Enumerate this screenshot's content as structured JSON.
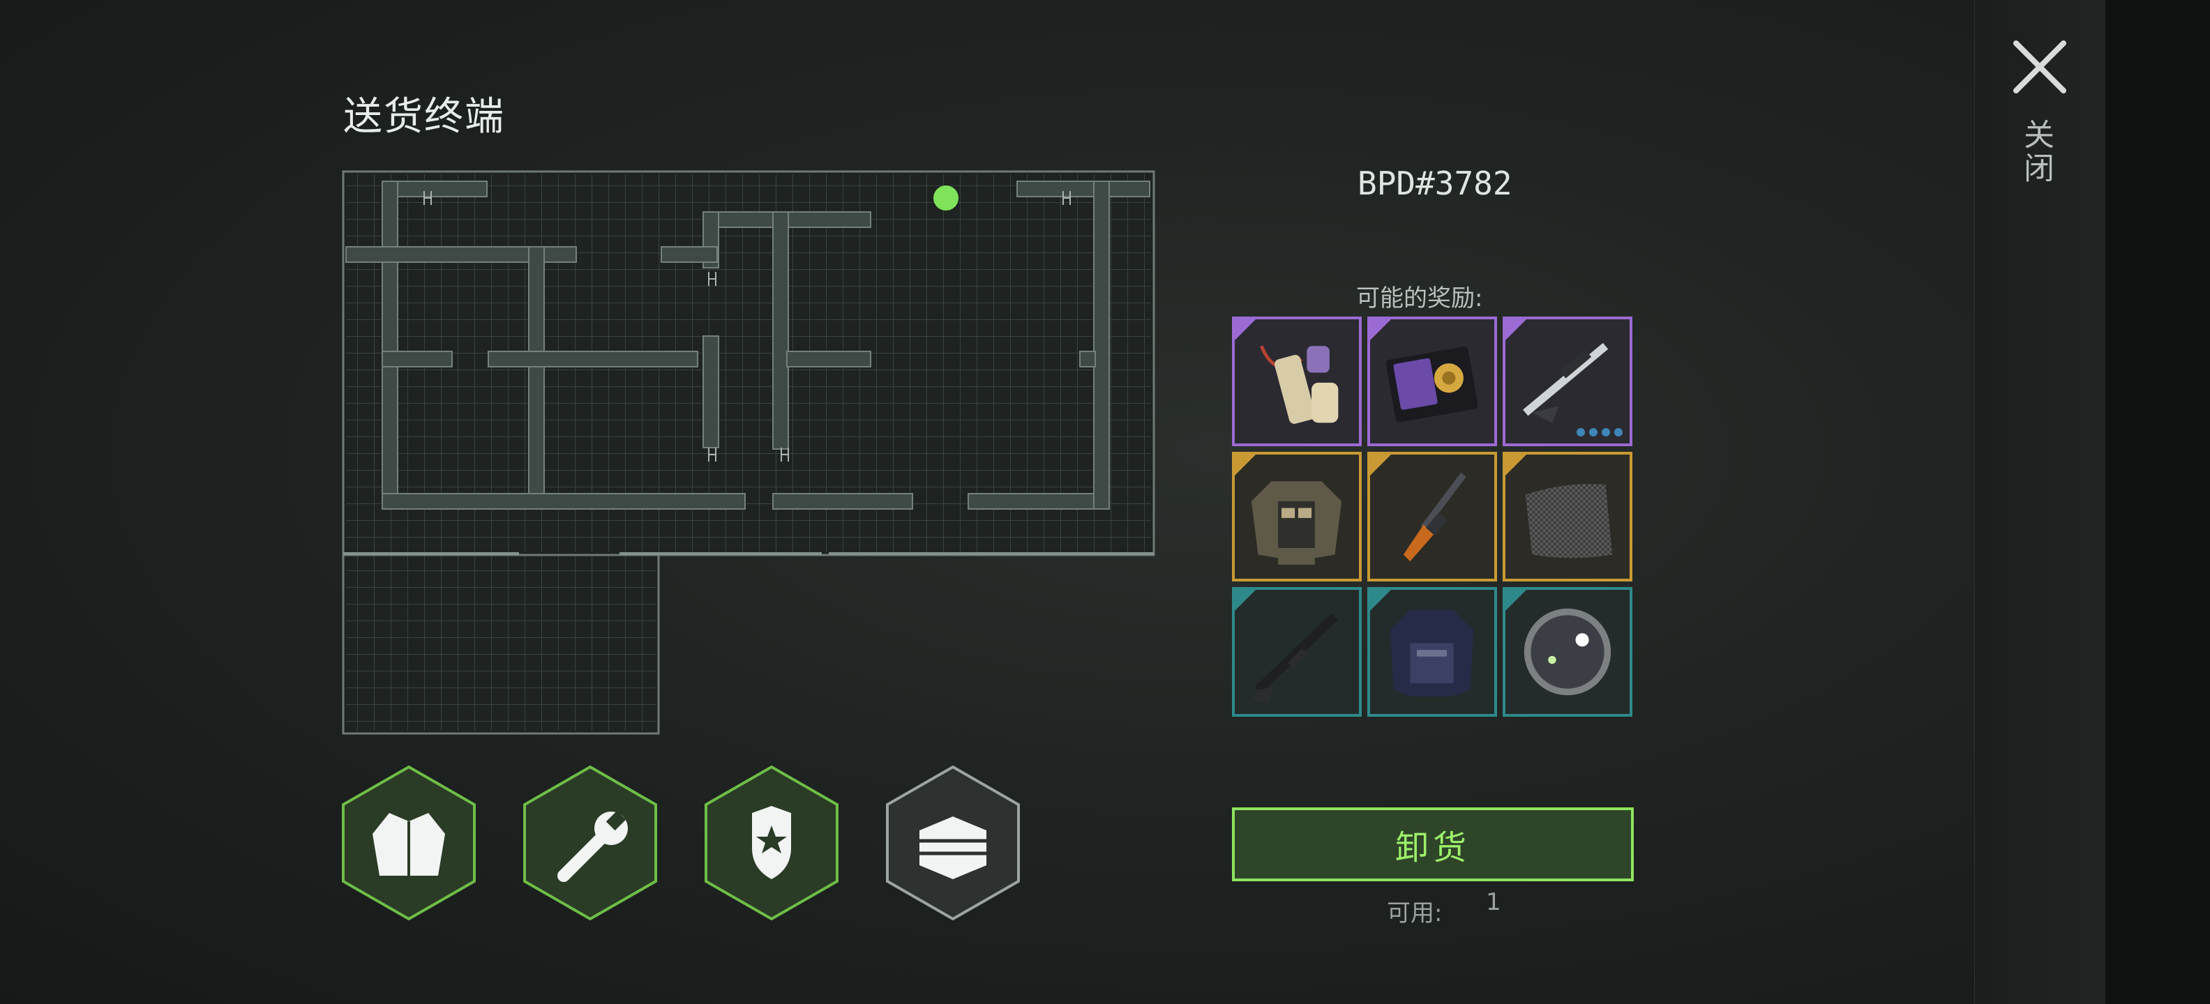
{
  "header": {
    "title": "送货终端"
  },
  "terminal": {
    "code": "BPD#3782"
  },
  "rewards": {
    "label": "可能的奖励:",
    "items": [
      {
        "name": "scroll-pack",
        "rarity": "purple"
      },
      {
        "name": "police-badge-wallet",
        "rarity": "purple"
      },
      {
        "name": "sniper-rifle",
        "rarity": "purple",
        "dots": 4
      },
      {
        "name": "tactical-jacket",
        "rarity": "gold"
      },
      {
        "name": "pistol-carbine",
        "rarity": "gold"
      },
      {
        "name": "carbon-fabric",
        "rarity": "gold"
      },
      {
        "name": "assault-rifle",
        "rarity": "teal"
      },
      {
        "name": "police-vest",
        "rarity": "teal"
      },
      {
        "name": "optic-lens",
        "rarity": "teal"
      }
    ]
  },
  "actions": {
    "unload_label": "卸货",
    "available_label": "可用:",
    "available_value": "1",
    "close_label": "关闭"
  },
  "categories": [
    {
      "name": "clothing",
      "icon": "jacket-icon",
      "state": "active"
    },
    {
      "name": "tools",
      "icon": "wrench-icon",
      "state": "active"
    },
    {
      "name": "police",
      "icon": "police-badge-icon",
      "state": "selected"
    },
    {
      "name": "supplies",
      "icon": "crate-icon",
      "state": "inactive"
    }
  ],
  "colors": {
    "accent_green": "#8ee35f",
    "purple": "#9b6ad3",
    "gold": "#c99a34",
    "teal": "#2e8a8a",
    "map_marker": "#7ee35a"
  }
}
